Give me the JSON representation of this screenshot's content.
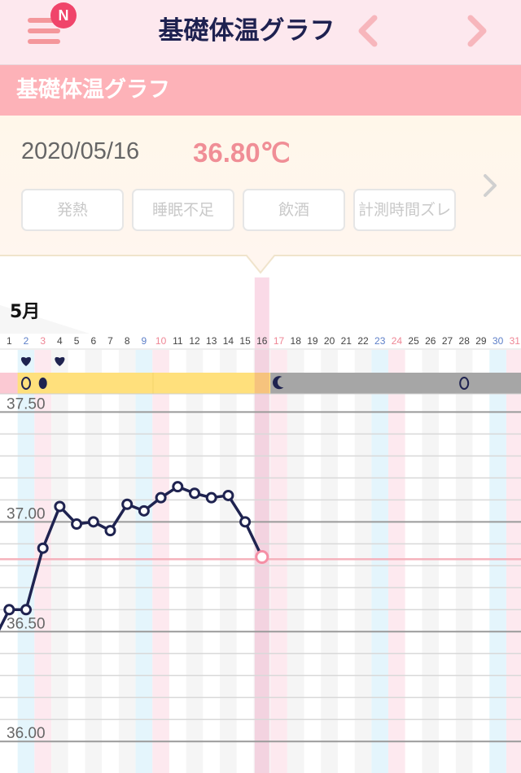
{
  "nav": {
    "title": "基礎体温グラフ",
    "badge": "N",
    "colors": {
      "bar": "#fde8ee",
      "accent": "#f4979b",
      "badge": "#f0446a",
      "title": "#1e2150",
      "arrow": "#f7b6bc"
    },
    "icons": [
      "menu-icon",
      "chevron-left-icon",
      "chevron-right-icon"
    ]
  },
  "section": {
    "title": "基礎体温グラフ",
    "color": "#fdb2b8"
  },
  "detail": {
    "date": "2020/05/16",
    "temperature": "36.80℃",
    "tags": [
      "発熱",
      "睡眠不足",
      "飲酒",
      "計測時間ズレ"
    ],
    "icons": [
      "chevron-right-icon"
    ]
  },
  "chart_data": {
    "type": "line",
    "month_label": "5月",
    "x": [
      1,
      2,
      3,
      4,
      5,
      6,
      7,
      8,
      9,
      10,
      11,
      12,
      13,
      14,
      15,
      16,
      17,
      18,
      19,
      20,
      21,
      22,
      23,
      24,
      25,
      26,
      27,
      28,
      29,
      30,
      31
    ],
    "day_colors": {
      "blue": [
        2,
        9,
        23,
        30
      ],
      "red": [
        3,
        10,
        17,
        24,
        31
      ]
    },
    "selected_day": 16,
    "series": [
      {
        "x": [
          1,
          2,
          3,
          4,
          5,
          6,
          7,
          8,
          9,
          10,
          11,
          12,
          13,
          14,
          15,
          16
        ],
        "values": [
          36.6,
          36.6,
          36.88,
          37.07,
          36.99,
          37.0,
          36.96,
          37.08,
          37.05,
          37.11,
          37.16,
          37.13,
          37.11,
          37.12,
          37.0,
          36.84
        ]
      }
    ],
    "y_ticks": [
      "37.50",
      "37.00",
      "36.50",
      "36.00"
    ],
    "ylim": [
      35.96,
      37.52
    ],
    "reference_line": 36.83,
    "markers": {
      "heart_days": [
        2,
        4
      ],
      "ovulation_test_days": [
        {
          "day": 2,
          "style": "outline"
        },
        {
          "day": 3,
          "style": "filled"
        },
        {
          "day": 28,
          "style": "outline"
        }
      ],
      "moon_day": 17
    },
    "phase_band": [
      {
        "from": 1,
        "to": 16,
        "color": "#ffe07c"
      },
      {
        "from": 17,
        "to": 31,
        "color": "#a6a6a6"
      }
    ],
    "colors": {
      "line": "#1f2350",
      "selected": "#f58fa5",
      "weekday_blue": "#5d7fc8",
      "weekday_red": "#ee8695"
    }
  }
}
